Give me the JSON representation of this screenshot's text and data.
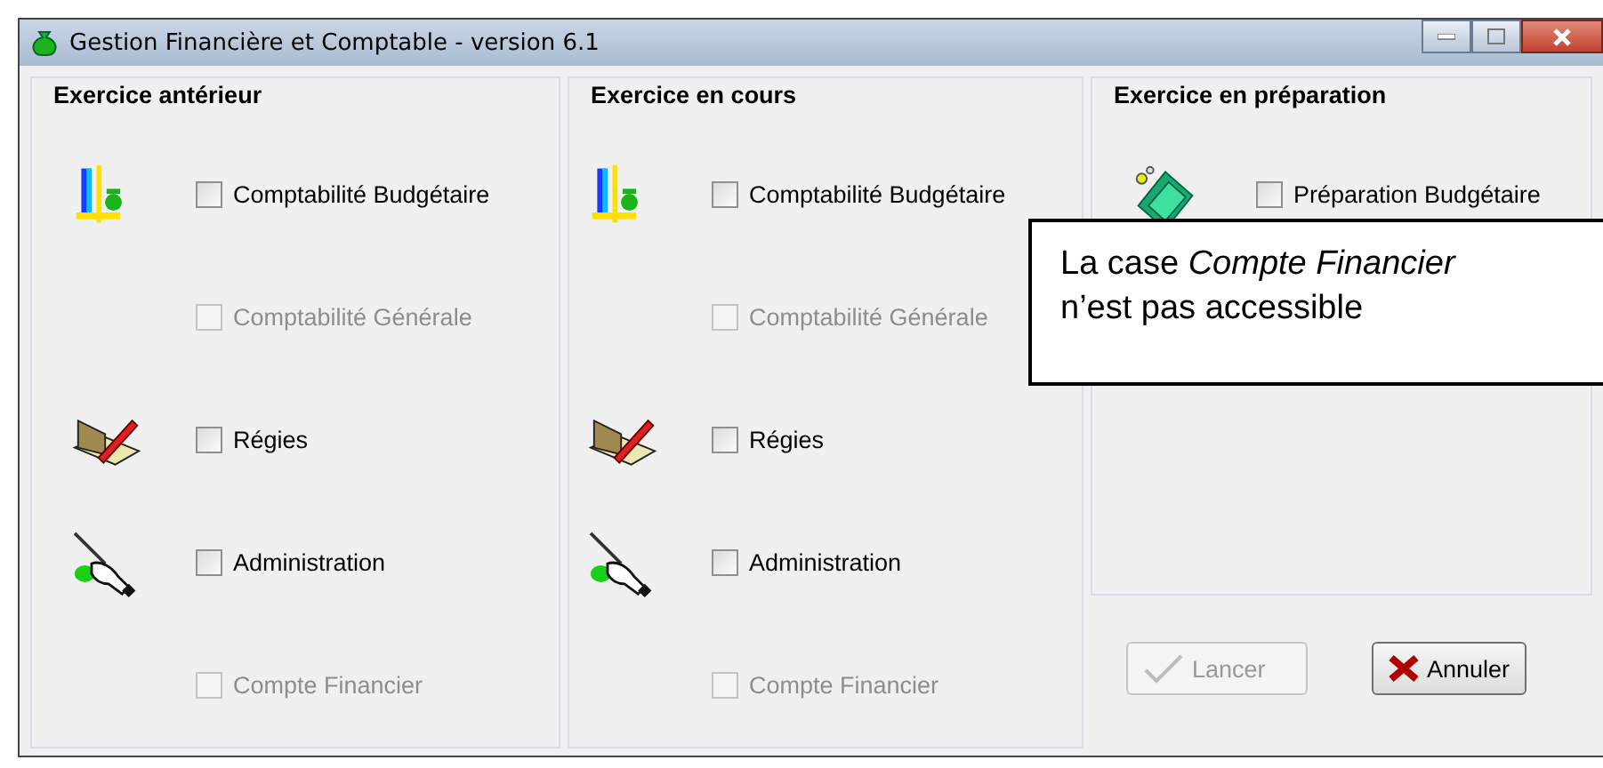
{
  "window": {
    "title": "Gestion Financière et Comptable - version 6.1"
  },
  "groups": [
    {
      "title": "Exercice antérieur",
      "items": [
        {
          "kind": "scale",
          "label": "Comptabilité Budgétaire",
          "checked": false,
          "disabled": false
        },
        {
          "kind": "plain",
          "label": "Comptabilité Générale",
          "checked": false,
          "disabled": true
        },
        {
          "kind": "book",
          "label": "Régies",
          "checked": false,
          "disabled": false
        },
        {
          "kind": "hand",
          "label": "Administration",
          "checked": false,
          "disabled": false
        },
        {
          "kind": "plain",
          "label": "Compte Financier",
          "checked": false,
          "disabled": true
        }
      ]
    },
    {
      "title": "Exercice en cours",
      "items": [
        {
          "kind": "scale",
          "label": "Comptabilité Budgétaire",
          "checked": false,
          "disabled": false
        },
        {
          "kind": "plain",
          "label": "Comptabilité Générale",
          "checked": false,
          "disabled": true
        },
        {
          "kind": "book",
          "label": "Régies",
          "checked": false,
          "disabled": false
        },
        {
          "kind": "hand",
          "label": "Administration",
          "checked": false,
          "disabled": false
        },
        {
          "kind": "plain",
          "label": "Compte Financier",
          "checked": false,
          "disabled": true
        }
      ]
    },
    {
      "title": "Exercice en préparation",
      "items": [
        {
          "kind": "money",
          "label": "Préparation Budgétaire",
          "checked": false,
          "disabled": false
        }
      ]
    }
  ],
  "buttons": [
    {
      "kind": "ok",
      "label": "Lancer",
      "disabled": true
    },
    {
      "kind": "cancel",
      "label": "Annuler",
      "disabled": false
    }
  ],
  "callout": {
    "text": "La case *Compte Financier* n’est pas accessible"
  }
}
